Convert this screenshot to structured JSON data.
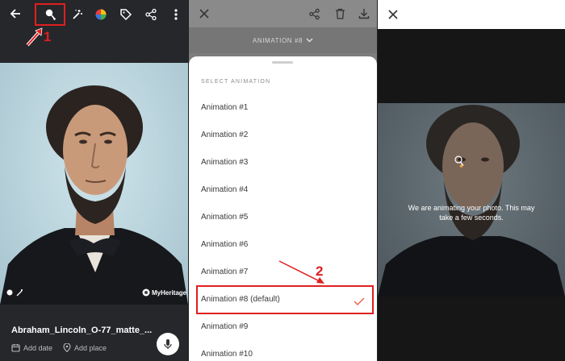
{
  "panel1": {
    "photo_watermark": "MyHeritage",
    "file_name": "Abraham_Lincoln_O-77_matte_...",
    "add_date": "Add date",
    "add_place": "Add place",
    "annotation_number": "1"
  },
  "panel2": {
    "current_selection": "ANIMATION #8",
    "sheet_title": "SELECT ANIMATION",
    "options": [
      "Animation #1",
      "Animation #2",
      "Animation #3",
      "Animation #4",
      "Animation #5",
      "Animation #6",
      "Animation #7",
      "Animation #8 (default)",
      "Animation #9",
      "Animation #10"
    ],
    "selected_index": 7,
    "annotation_number": "2"
  },
  "panel3": {
    "message": "We are animating your photo. This may take a few seconds."
  },
  "colors": {
    "annotation_red": "#e01f1f",
    "checkmark": "#e8604c"
  }
}
